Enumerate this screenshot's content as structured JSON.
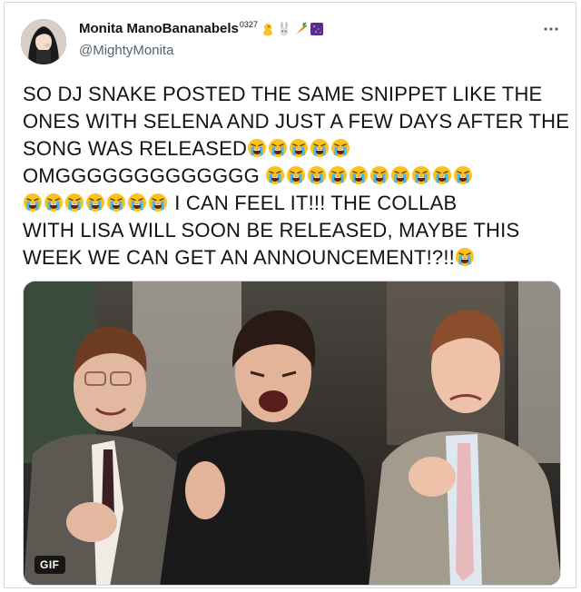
{
  "author": {
    "display_name": "Monita ManoBananabels",
    "superscript": "0327",
    "badges": [
      "chick-emoji",
      "rabbit-emoji",
      "carrot-emoji",
      "purple-square-emoji"
    ],
    "handle": "@MightyMonita"
  },
  "tweet": {
    "lines": [
      {
        "text": "SO DJ SNAKE POSTED THE SAME SNIPPET LIKE THE",
        "emojis_after": 0,
        "emojis_before": 0,
        "suffix": ""
      },
      {
        "text": "ONES WITH SELENA AND JUST A FEW DAYS AFTER THE",
        "emojis_after": 0,
        "emojis_before": 0,
        "suffix": ""
      },
      {
        "text": "SONG WAS RELEASED",
        "emojis_after": 5,
        "emojis_before": 0,
        "suffix": ""
      },
      {
        "text": "OMGGGGGGGGGGGGG ",
        "emojis_after": 10,
        "emojis_before": 0,
        "suffix": ""
      },
      {
        "text": " I CAN FEEL IT!!! THE COLLAB",
        "emojis_after": 0,
        "emojis_before": 7,
        "suffix": ""
      },
      {
        "text": "WITH LISA WILL SOON BE RELEASED, MAYBE THIS",
        "emojis_after": 0,
        "emojis_before": 0,
        "suffix": ""
      },
      {
        "text": "WEEK WE CAN GET AN ANNOUNCEMENT!?!!",
        "emojis_after": 1,
        "emojis_before": 0,
        "suffix": ""
      }
    ],
    "emoji_name": "loudly-crying-face"
  },
  "media": {
    "type": "gif",
    "badge_label": "GIF"
  },
  "colors": {
    "text": "#0f1419",
    "secondary": "#536471",
    "border": "#cfd9de"
  }
}
